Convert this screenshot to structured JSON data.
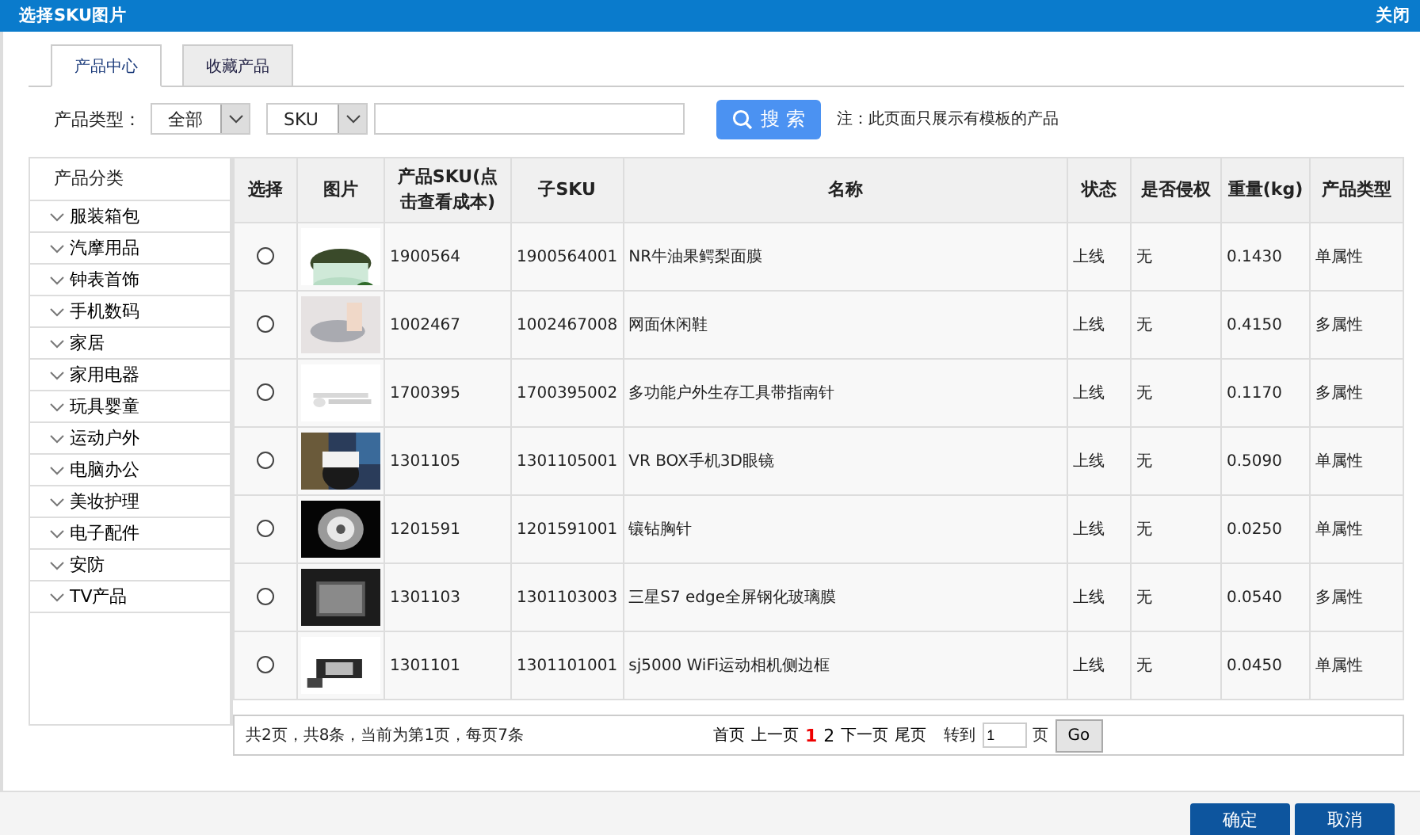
{
  "window": {
    "title": "选择SKU图片",
    "close": "关闭"
  },
  "tabs": [
    {
      "label": "产品中心",
      "selected": true
    },
    {
      "label": "收藏产品",
      "selected": false
    }
  ],
  "filters": {
    "type_label": "产品类型：",
    "type_value": "全部",
    "field_value": "SKU",
    "search_button": "搜 索",
    "note": "注：此页面只展示有模板的产品"
  },
  "sidebar": {
    "title": "产品分类",
    "items": [
      "服装箱包",
      "汽摩用品",
      "钟表首饰",
      "手机数码",
      "家居",
      "家用电器",
      "玩具婴童",
      "运动户外",
      "电脑办公",
      "美妆护理",
      "电子配件",
      "安防",
      "TV产品"
    ]
  },
  "table": {
    "columns": [
      "选择",
      "图片",
      "产品SKU(点击查看成本)",
      "子SKU",
      "名称",
      "状态",
      "是否侵权",
      "重量(kg)",
      "产品类型"
    ],
    "rows": [
      {
        "selected": false,
        "sku": "1900564",
        "sub_sku": "1900564001",
        "name": "NR牛油果鳄梨面膜",
        "status": "上线",
        "infringing": "无",
        "weight": "0.1430",
        "type": "单属性"
      },
      {
        "selected": false,
        "sku": "1002467",
        "sub_sku": "1002467008",
        "name": "网面休闲鞋",
        "status": "上线",
        "infringing": "无",
        "weight": "0.4150",
        "type": "多属性"
      },
      {
        "selected": false,
        "sku": "1700395",
        "sub_sku": "1700395002",
        "name": "多功能户外生存工具带指南针",
        "status": "上线",
        "infringing": "无",
        "weight": "0.1170",
        "type": "多属性"
      },
      {
        "selected": false,
        "sku": "1301105",
        "sub_sku": "1301105001",
        "name": "VR BOX手机3D眼镜",
        "status": "上线",
        "infringing": "无",
        "weight": "0.5090",
        "type": "单属性"
      },
      {
        "selected": false,
        "sku": "1201591",
        "sub_sku": "1201591001",
        "name": "镶钻胸针",
        "status": "上线",
        "infringing": "无",
        "weight": "0.0250",
        "type": "单属性"
      },
      {
        "selected": false,
        "sku": "1301103",
        "sub_sku": "1301103003",
        "name": "三星S7 edge全屏钢化玻璃膜",
        "status": "上线",
        "infringing": "无",
        "weight": "0.0540",
        "type": "多属性"
      },
      {
        "selected": false,
        "sku": "1301101",
        "sub_sku": "1301101001",
        "name": "sj5000 WiFi运动相机侧边框",
        "status": "上线",
        "infringing": "无",
        "weight": "0.0450",
        "type": "单属性"
      }
    ]
  },
  "pagination": {
    "summary": "共2页，共8条，当前为第1页，每页7条",
    "first": "首页",
    "prev": "上一页",
    "pages": [
      {
        "label": "1",
        "selected": true
      },
      {
        "label": "2",
        "selected": false
      }
    ],
    "next": "下一页",
    "last": "尾页",
    "goto_label": "转到",
    "goto_value": "1",
    "page_unit": "页",
    "go": "Go"
  },
  "buttons": {
    "confirm": "确定",
    "cancel": "取消"
  }
}
